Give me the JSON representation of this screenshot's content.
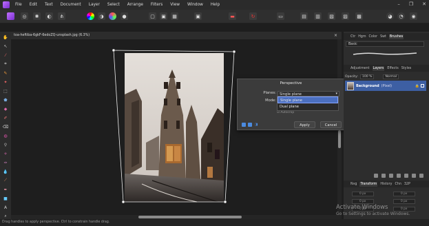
{
  "menu": [
    "File",
    "Edit",
    "Text",
    "Document",
    "Layer",
    "Select",
    "Arrange",
    "Filters",
    "View",
    "Window",
    "Help"
  ],
  "document_tab": {
    "title": "toa-heftiba-6gkF-6edoZQ-unsplash.jpg (6.3%)",
    "close": "×"
  },
  "dialog": {
    "title": "Perspective",
    "planes_label": "Planes:",
    "planes_value": "Single plane",
    "mode_label": "Mode:",
    "dropdown_options": [
      "Single plane",
      "Dual plane"
    ],
    "sub_option": "☑ Autocrop",
    "apply_label": "Apply",
    "cancel_label": "Cancel"
  },
  "panel": {
    "top_tabs": [
      "Ctr",
      "Hgm",
      "Color",
      "Swt",
      "Brushes"
    ],
    "brush_category": "Basic",
    "layer_tabs": [
      "Adjustment",
      "Layers",
      "Effects",
      "Styles"
    ],
    "opacity_label": "Opacity:",
    "opacity_value": "100 %",
    "blend_mode": "Normal",
    "layer_name": "Background",
    "layer_suffix": "(Pixel)",
    "bottom_tabs": [
      "Nvg",
      "Transform",
      "History",
      "Chn",
      "32P"
    ],
    "transform_fields": [
      "0 px",
      "0 px",
      "0 px",
      "0 px",
      "0 px",
      "0 px"
    ]
  },
  "status": {
    "text": "Drag handles to apply perspective. Ctrl to constrain handle drag."
  },
  "watermark": {
    "line1": "Activate Windows",
    "line2": "Go to Settings to activate Windows."
  },
  "colors": {
    "accent": "#4b6fc0",
    "app_logo": "#9b4dff"
  }
}
